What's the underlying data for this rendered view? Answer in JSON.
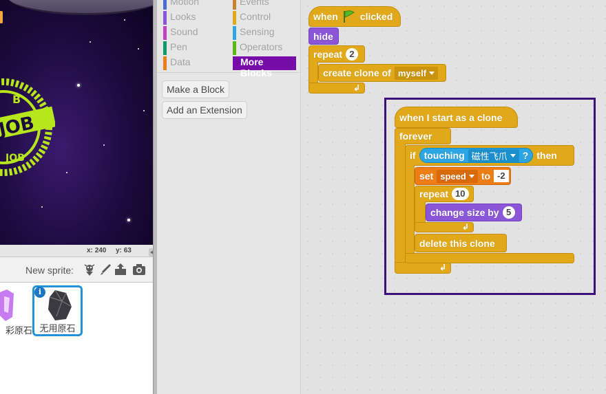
{
  "colors": {
    "control": "#e1a91a",
    "looks": "#8a55d7",
    "data": "#ee7d16",
    "sensing": "#2ca5e2",
    "more_blocks": "#770ca8",
    "selection": "#3c0f7c",
    "sprite_selected": "#2592d8"
  },
  "stage": {
    "coord_x_label": "x:",
    "coord_x": "240",
    "coord_y_label": "y:",
    "coord_y": "63",
    "logo_text_top": "B",
    "logo_text_mid": "JOB",
    "logo_text_low": "JOB"
  },
  "sprites": {
    "new_sprite_label": "New sprite:",
    "tools": [
      "paint-from-library-icon",
      "paint-brush-icon",
      "upload-icon",
      "camera-icon"
    ],
    "items": [
      {
        "name": "彩原石"
      },
      {
        "name": "无用原石",
        "info_icon": "i"
      }
    ]
  },
  "palette": {
    "categories": [
      {
        "label": "Motion",
        "color": "#4a6cd4"
      },
      {
        "label": "Looks",
        "color": "#8a55d7"
      },
      {
        "label": "Sound",
        "color": "#bb42c3"
      },
      {
        "label": "Pen",
        "color": "#0e9a6c"
      },
      {
        "label": "Data",
        "color": "#ee7d16"
      },
      {
        "label": "Events",
        "color": "#c88330"
      },
      {
        "label": "Control",
        "color": "#e1a91a"
      },
      {
        "label": "Sensing",
        "color": "#2ca5e2"
      },
      {
        "label": "Operators",
        "color": "#5cb712"
      },
      {
        "label": "More Blocks",
        "color": "#770ca8"
      }
    ],
    "make_block": "Make a Block",
    "add_extension": "Add an Extension"
  },
  "scripts": {
    "when_label": "when",
    "clicked_label": "clicked",
    "hide": "hide",
    "repeat_label": "repeat",
    "repeat_count_1": "2",
    "create_clone_label": "create clone of",
    "create_clone_target": "myself",
    "start_clone": "when I start as a clone",
    "forever": "forever",
    "if_label": "if",
    "touching_label": "touching",
    "touching_target": "磁性飞爪",
    "touching_q": "?",
    "then_label": "then",
    "set_label": "set",
    "set_var": "speed",
    "to_label": "to",
    "set_value": "-2",
    "repeat_count_2": "10",
    "change_size_label": "change size by",
    "change_size_value": "5",
    "delete_clone": "delete this clone"
  }
}
